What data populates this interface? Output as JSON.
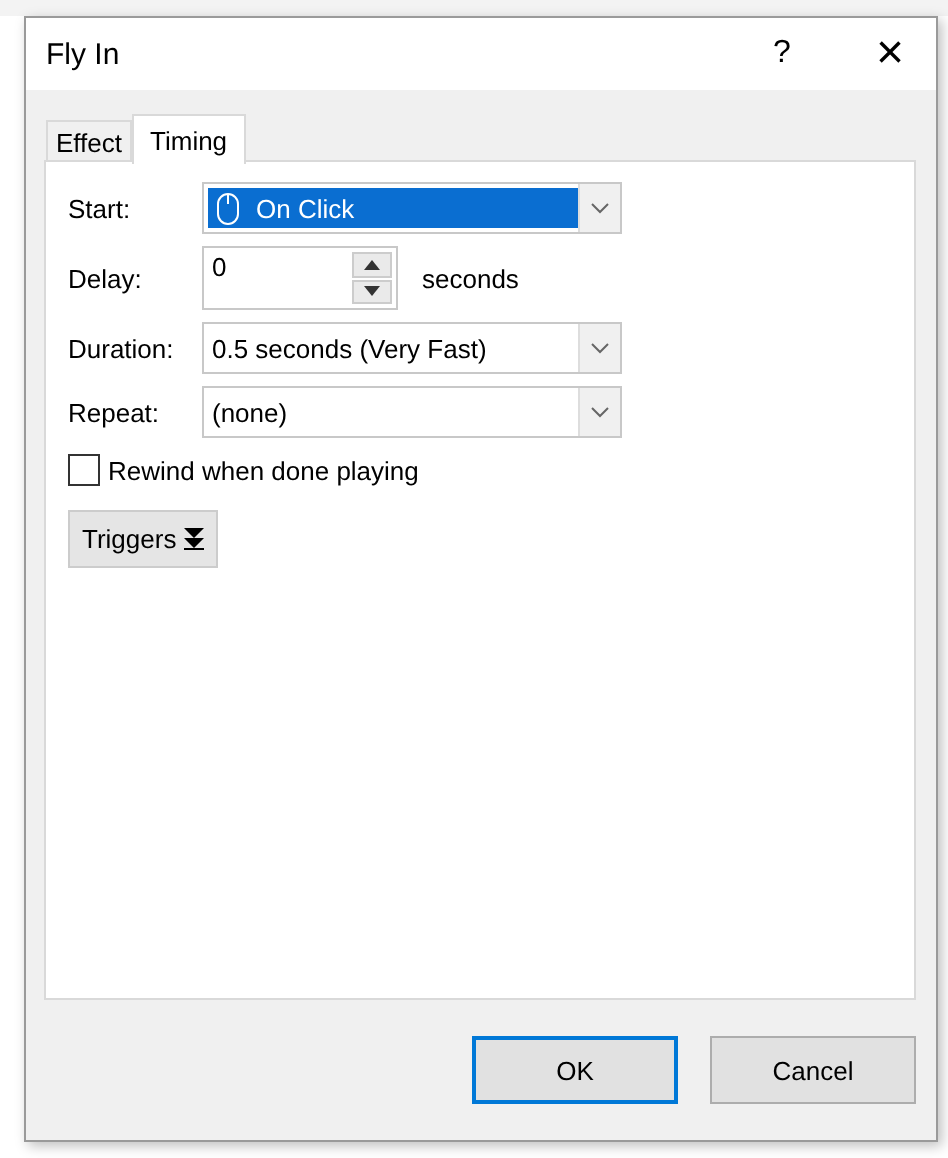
{
  "window": {
    "title": "Fly In",
    "help": "?",
    "close": "×"
  },
  "tabs": [
    {
      "label": "Effect",
      "selected": false
    },
    {
      "label": "Timing",
      "selected": true
    }
  ],
  "fields": [
    {
      "kind": "dropdown",
      "label": "Start:",
      "value": "On Click",
      "highlighted": true,
      "mouse_icon": true
    },
    {
      "kind": "spinner",
      "label": "Delay:",
      "value": "0",
      "unit": "seconds"
    },
    {
      "kind": "dropdown",
      "label": "Duration:",
      "value": "0.5 seconds (Very Fast)",
      "highlighted": false,
      "mouse_icon": false
    },
    {
      "kind": "dropdown",
      "label": "Repeat:",
      "value": "(none)",
      "highlighted": false,
      "mouse_icon": false
    }
  ],
  "rewind": {
    "label": "Rewind when done playing",
    "checked": false
  },
  "triggers_button": {
    "label": "Triggers"
  },
  "buttons": [
    {
      "label": "OK",
      "default": true
    },
    {
      "label": "Cancel",
      "default": false
    }
  ]
}
